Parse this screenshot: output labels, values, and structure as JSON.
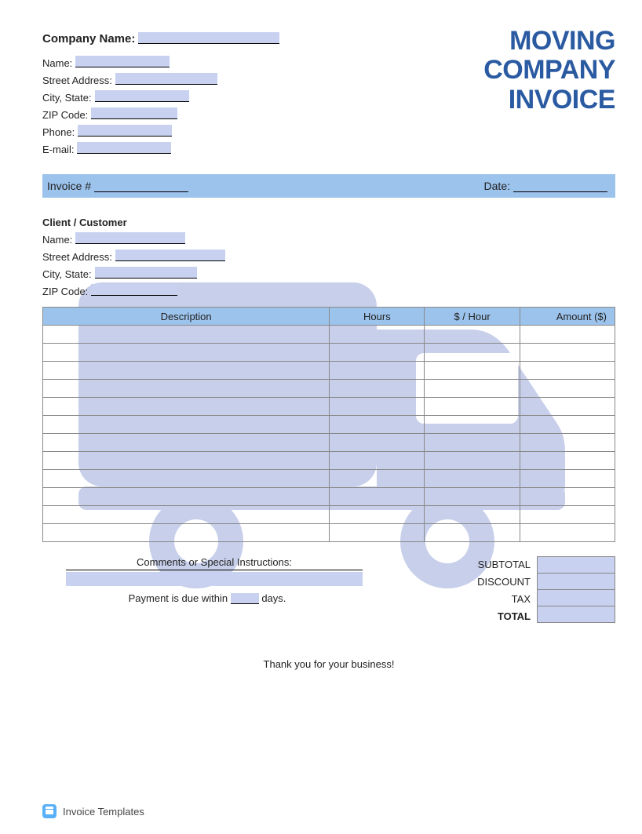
{
  "title": {
    "line1": "MOVING",
    "line2": "COMPANY",
    "line3": "INVOICE"
  },
  "company": {
    "company_name_label": "Company Name:",
    "name_label": "Name:",
    "street_label": "Street Address:",
    "city_state_label": "City, State:",
    "zip_label": "ZIP Code:",
    "phone_label": "Phone:",
    "email_label": "E-mail:",
    "company_name": "",
    "name": "",
    "street": "",
    "city_state": "",
    "zip": "",
    "phone": "",
    "email": ""
  },
  "bar": {
    "invoice_label": "Invoice #",
    "invoice_no": "",
    "date_label": "Date:",
    "date": ""
  },
  "client": {
    "header": "Client / Customer",
    "name_label": "Name:",
    "street_label": "Street Address:",
    "city_state_label": "City, State:",
    "zip_label": "ZIP Code:",
    "name": "",
    "street": "",
    "city_state": "",
    "zip": ""
  },
  "table": {
    "headers": {
      "description": "Description",
      "hours": "Hours",
      "rate": "$ / Hour",
      "amount": "Amount ($)"
    },
    "row_count": 12
  },
  "bottom": {
    "comments_label": "Comments or Special Instructions:",
    "comments": "",
    "payment_prefix": "Payment is due within",
    "payment_days": "",
    "payment_suffix": "days."
  },
  "totals": {
    "subtotal_label": "SUBTOTAL",
    "discount_label": "DISCOUNT",
    "tax_label": "TAX",
    "total_label": "TOTAL",
    "subtotal": "",
    "discount": "",
    "tax": "",
    "total": ""
  },
  "thanks": "Thank you for your business!",
  "footer": {
    "brand": "Invoice Templates"
  }
}
